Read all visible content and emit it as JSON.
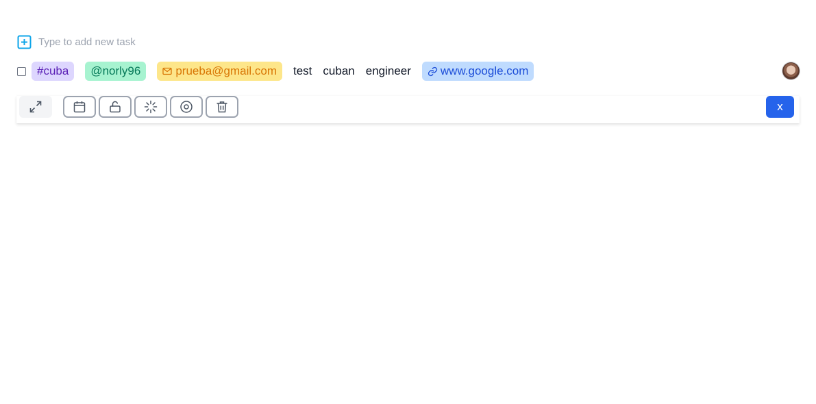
{
  "new_task": {
    "placeholder": "Type to add new task",
    "icon": "plus-square-icon"
  },
  "task": {
    "checked": false,
    "tag": "#cuba",
    "mention": "@norly96",
    "email": "prueba@gmail.com",
    "words": [
      "test",
      "cuban",
      "engineer"
    ],
    "link": "www.google.com",
    "avatar": "user-avatar"
  },
  "toolbar": {
    "buttons": [
      {
        "name": "expand",
        "icon": "expand-arrows-icon"
      },
      {
        "name": "calendar",
        "icon": "calendar-icon"
      },
      {
        "name": "unlock",
        "icon": "unlock-icon"
      },
      {
        "name": "loading",
        "icon": "loader-icon"
      },
      {
        "name": "record",
        "icon": "disc-icon"
      },
      {
        "name": "delete",
        "icon": "trash-icon"
      }
    ],
    "close_label": "x"
  },
  "colors": {
    "accent": "#2563eb",
    "add_icon": "#0ea5e9",
    "tag_bg": "#ddd6fe",
    "tag_text": "#5b21b6",
    "mention_bg": "#a7f3d0",
    "mention_text": "#047857",
    "email_bg": "#fde68a",
    "email_text": "#d97706",
    "link_bg": "#bfdbfe",
    "link_text": "#1d4ed8"
  }
}
